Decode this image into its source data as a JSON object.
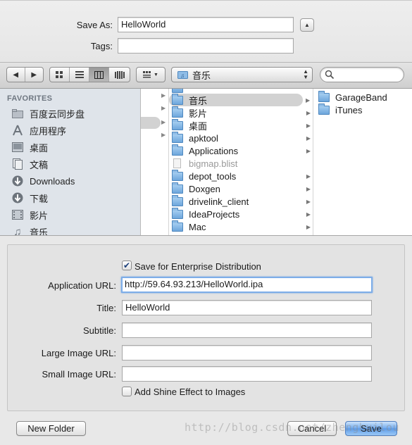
{
  "save_as": {
    "label": "Save As:",
    "value": "HelloWorld"
  },
  "tags": {
    "label": "Tags:",
    "value": ""
  },
  "toolbar": {
    "location": "音乐"
  },
  "sidebar": {
    "heading": "FAVORITES",
    "items": [
      {
        "label": "百度云同步盘",
        "icon": "folder-icon"
      },
      {
        "label": "应用程序",
        "icon": "applications-icon"
      },
      {
        "label": "桌面",
        "icon": "desktop-icon"
      },
      {
        "label": "文稿",
        "icon": "documents-icon"
      },
      {
        "label": "Downloads",
        "icon": "downloads-icon"
      },
      {
        "label": "下载",
        "icon": "downloads-icon"
      },
      {
        "label": "影片",
        "icon": "movies-icon"
      },
      {
        "label": "音乐",
        "icon": "music-icon"
      }
    ]
  },
  "browser": {
    "column2": [
      {
        "label": "音乐",
        "icon": "music-folder-icon",
        "selected": true
      },
      {
        "label": "影片",
        "icon": "movies-folder-icon"
      },
      {
        "label": "桌面",
        "icon": "desktop-folder-icon"
      },
      {
        "label": "apktool",
        "icon": "folder-icon"
      },
      {
        "label": "Applications",
        "icon": "applications-folder-icon"
      },
      {
        "label": "bigmap.blist",
        "icon": "document-icon",
        "disabled": true
      },
      {
        "label": "depot_tools",
        "icon": "folder-icon"
      },
      {
        "label": "Doxgen",
        "icon": "folder-icon"
      },
      {
        "label": "drivelink_client",
        "icon": "folder-icon"
      },
      {
        "label": "IdeaProjects",
        "icon": "folder-icon"
      },
      {
        "label": "Mac",
        "icon": "folder-icon"
      }
    ],
    "column3": [
      {
        "label": "GarageBand",
        "icon": "folder-icon"
      },
      {
        "label": "iTunes",
        "icon": "folder-icon"
      }
    ]
  },
  "enterprise": {
    "save_checkbox": {
      "label": "Save for Enterprise Distribution",
      "checked": true
    },
    "application_url": {
      "label": "Application URL:",
      "value": "http://59.64.93.213/HelloWorld.ipa"
    },
    "title": {
      "label": "Title:",
      "value": "HelloWorld"
    },
    "subtitle": {
      "label": "Subtitle:",
      "value": ""
    },
    "large_image_url": {
      "label": "Large Image URL:",
      "value": ""
    },
    "small_image_url": {
      "label": "Small Image URL:",
      "value": ""
    },
    "shine_checkbox": {
      "label": "Add Shine Effect to Images",
      "checked": false
    }
  },
  "buttons": {
    "new_folder": "New Folder",
    "cancel": "Cancel",
    "save": "Save"
  },
  "watermark": "http://blog.csdn.net/zhenghuilou",
  "colors": {
    "accent": "#5b9ae6",
    "sidebar_bg": "#dfe4ea",
    "selection": "#d2d2d2"
  }
}
